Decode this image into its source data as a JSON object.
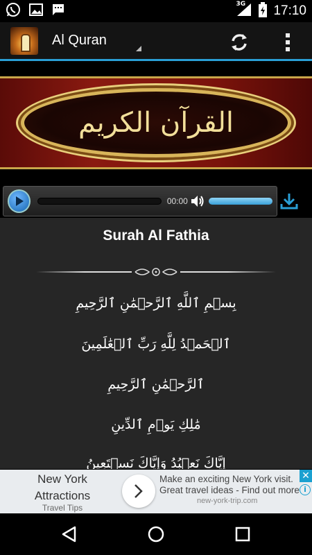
{
  "status_bar": {
    "time": "17:10",
    "network": "3G",
    "icons": [
      "whatsapp-icon",
      "image-icon",
      "message-icon",
      "signal-icon",
      "battery-icon"
    ]
  },
  "action_bar": {
    "title": "Al Quran",
    "icons": [
      "refresh-icon",
      "overflow-menu-icon"
    ]
  },
  "banner": {
    "text": "القرآن الكريم"
  },
  "player": {
    "time": "00:00",
    "volume": 1.0
  },
  "content": {
    "surah_title": "Surah Al Fathia",
    "verses": [
      "بِسۡمِ ٱللَّهِ ٱلرَّحۡمَٰنِ ٱلرَّحِيمِ",
      "ٱلۡحَمۡدُ لِلَّهِ رَبِّ ٱلۡعَٰلَمِينَ",
      "ٱلرَّحۡمَٰنِ ٱلرَّحِيمِ",
      "مَٰلِكِ يَوۡمِ ٱلدِّينِ",
      "إِيَّاكَ نَعۡبُدُ وَإِيَّاكَ نَسۡتَعِينُ"
    ]
  },
  "ad": {
    "headline_1": "New York",
    "headline_2": "Attractions",
    "sub": "Travel Tips",
    "line_1": "Make an exciting New York visit.",
    "line_2": "Great travel ideas - Find out more",
    "url": "new-york-trip.com",
    "close": "✕",
    "info": "i"
  },
  "colors": {
    "accent": "#2a9fd6",
    "banner_gold": "#d8b55a",
    "banner_red": "#8a1a10"
  }
}
